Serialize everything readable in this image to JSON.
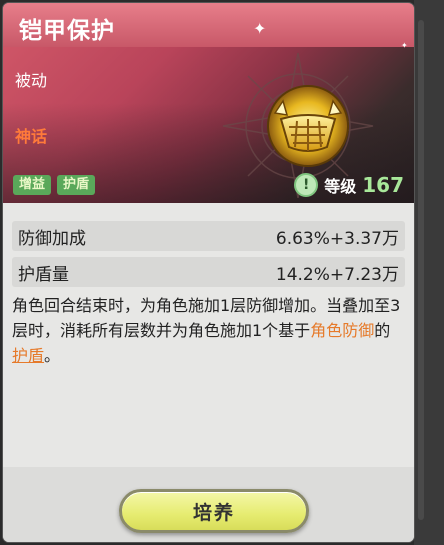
{
  "skill": {
    "title": "铠甲保护",
    "type": "被动",
    "rarity": "神话",
    "tags": [
      "增益",
      "护盾"
    ],
    "level_label": "等级",
    "level_value": "167",
    "icon": "golden-armor-shield-icon"
  },
  "stats": [
    {
      "name": "防御加成",
      "value": "6.63%+3.37万"
    },
    {
      "name": "护盾量",
      "value": "14.2%+7.23万"
    }
  ],
  "description": {
    "part1": "角色回合结束时，为角色施加1层防御增加。当叠加至3层时，消耗所有层数并为角色施加1个基于",
    "highlight1": "角色防御",
    "part2": "的",
    "highlight2": "护盾",
    "part3": "。"
  },
  "buttons": {
    "cultivate": "培养"
  },
  "colors": {
    "header_accent": "#c85868",
    "rarity_text": "#ff7a3a",
    "tag_bg": "#5aa85a",
    "level_num": "#a8e89a",
    "highlight": "#e67a2a",
    "button_bg": "#e6ec70"
  }
}
